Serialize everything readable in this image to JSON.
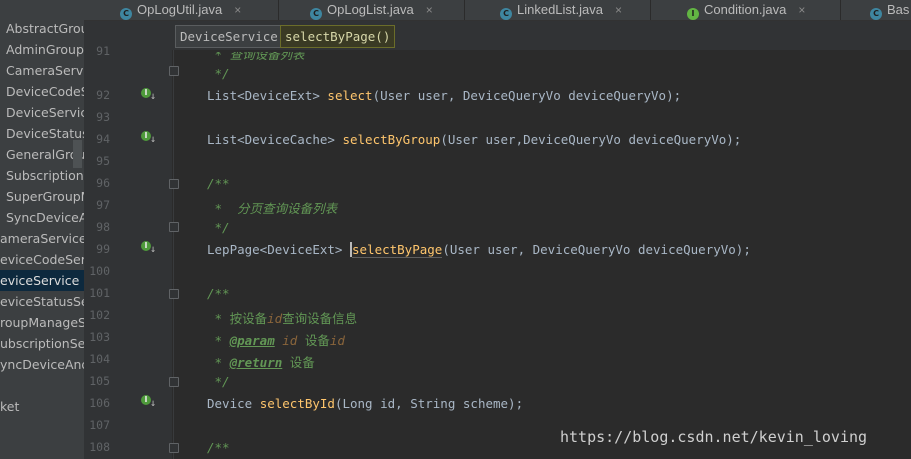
{
  "tree": {
    "items": [
      "AbstractGroup",
      "AdminGroupI",
      "CameraServiceImpl",
      "DeviceCodeS",
      "DeviceService",
      "DeviceStatusS",
      "GeneralGroup",
      "SubscriptionS",
      "SuperGroupM",
      "SyncDeviceAr",
      "ameraService",
      "eviceCodeServi",
      "eviceService",
      "eviceStatusServ",
      "roupManageSe",
      "ubscriptionServ",
      "yncDeviceAndC",
      "ket"
    ],
    "selected_index": 12
  },
  "tabs": [
    {
      "label": "OpLogUtil.java",
      "icon": "class-icon",
      "icon_letter": "C"
    },
    {
      "label": "OpLogList.java",
      "icon": "class-icon",
      "icon_letter": "C"
    },
    {
      "label": "LinkedList.java",
      "icon": "class-icon",
      "icon_letter": "C"
    },
    {
      "label": "Condition.java",
      "icon": "interface-icon",
      "icon_letter": "I"
    },
    {
      "label": "Bas",
      "icon": "class-icon",
      "icon_letter": "C"
    }
  ],
  "tab_close": "×",
  "breadcrumb": [
    "DeviceService",
    "selectByPage()"
  ],
  "lines": {
    "n91": "91",
    "n92": "92",
    "n93": "93",
    "n94": "94",
    "n95": "95",
    "n96": "96",
    "n97": "97",
    "n98": "98",
    "n99": "99",
    "n100": "100",
    "n101": "101",
    "n102": "102",
    "n103": "103",
    "n104": "104",
    "n105": "105",
    "n106": "106",
    "n107": "107",
    "n108": "108"
  },
  "code": {
    "l90_comment": " * 查询设备列表",
    "l91_comment": " */",
    "l92_type": "List<DeviceExt> ",
    "l92_fn": "select",
    "l92_args": "(User user, DeviceQueryVo deviceQueryVo);",
    "l94_type": "List<DeviceCache> ",
    "l94_fn": "selectByGroup",
    "l94_args": "(User user,DeviceQueryVo deviceQueryVo);",
    "l96_comment": "/**",
    "l97_comment": " *  分页查询设备列表",
    "l98_comment": " */",
    "l99_type": "LepPage<DeviceExt> ",
    "l99_fn": "selectByPage",
    "l99_args": "(User user, DeviceQueryVo deviceQueryVo);",
    "l101_comment": "/**",
    "l102_pre": " * 按设备",
    "l102_id": "id",
    "l102_post": "查询设备信息",
    "l103_pre": " * ",
    "l103_tag": "@param",
    "l103_name": " id",
    "l103_post": " 设备",
    "l103_id": "id",
    "l104_pre": " * ",
    "l104_tag": "@return",
    "l104_post": " 设备",
    "l105_comment": " */",
    "l106_type": "Device ",
    "l106_fn": "selectById",
    "l106_args": "(Long id, String scheme);",
    "l108_comment": "/**"
  },
  "watermark": "https://blog.csdn.net/kevin_loving"
}
